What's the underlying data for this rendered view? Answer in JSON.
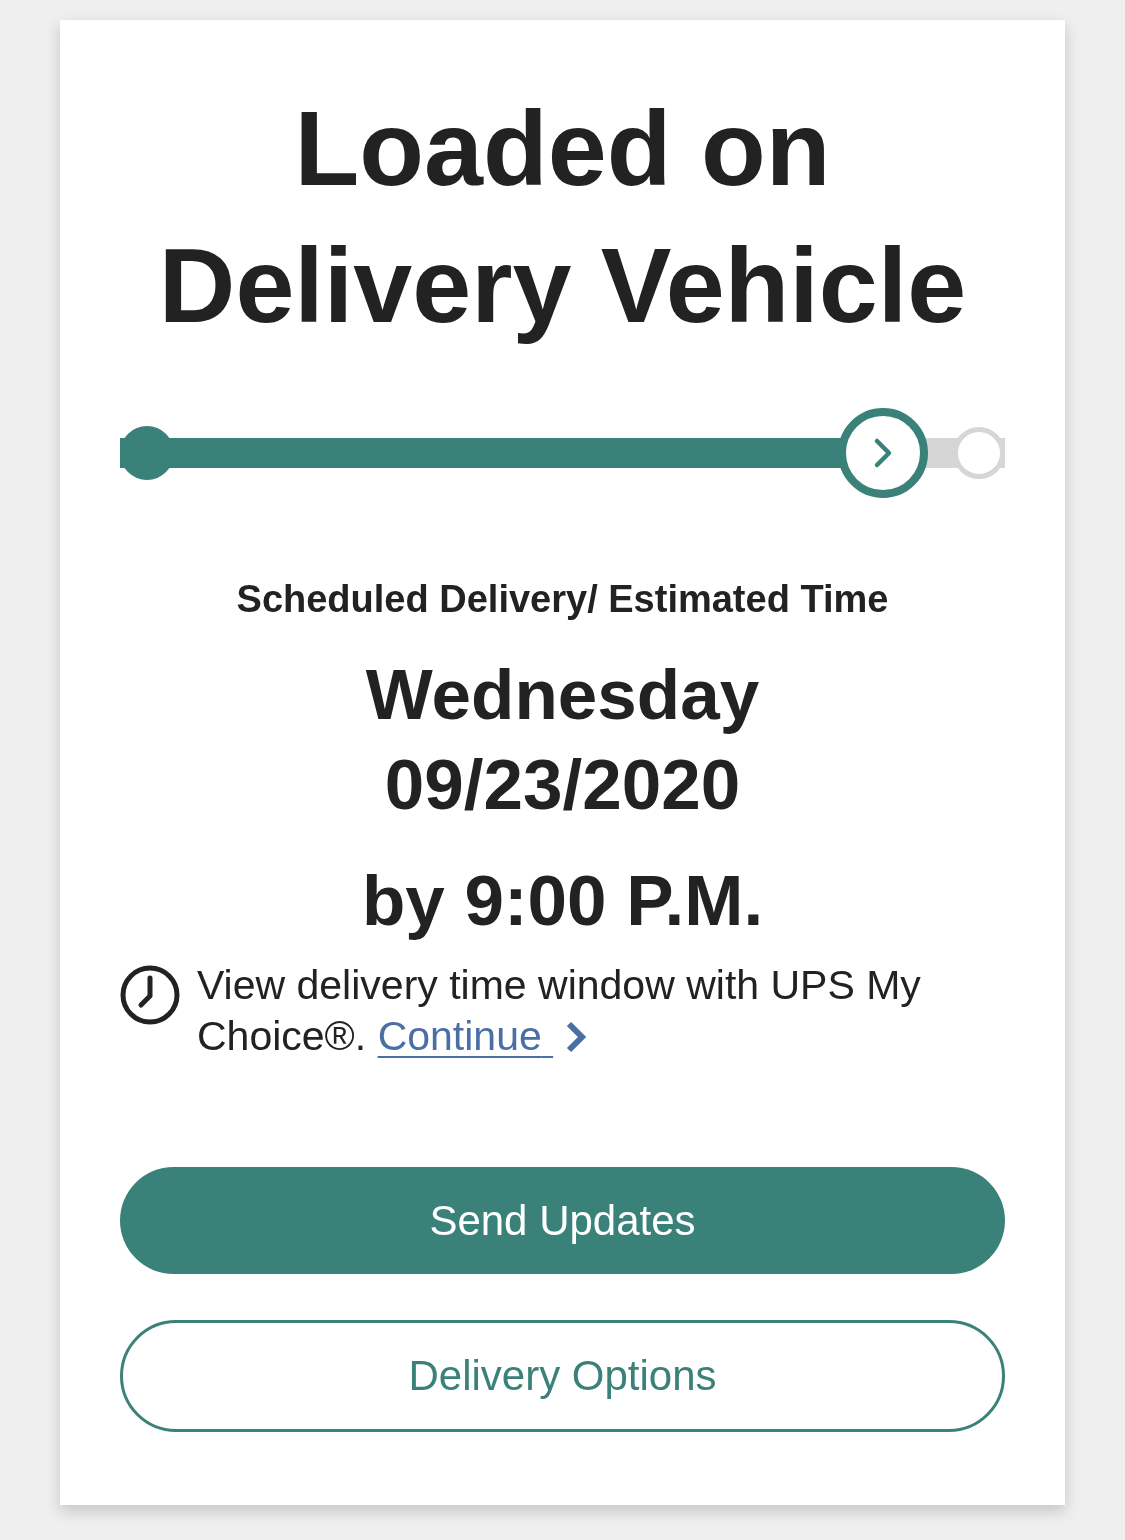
{
  "title": "Loaded on Delivery Vehicle",
  "progress": {
    "level": 0.862
  },
  "delivery": {
    "label": "Scheduled Delivery/ Estimated Time",
    "day": "Wednesday",
    "date": "09/23/2020",
    "time": "by 9:00 P.M."
  },
  "notice": {
    "text": "View delivery time window with UPS My Choice®.",
    "link": "Continue"
  },
  "buttons": [
    {
      "label": "Send Updates",
      "kind": "primary"
    },
    {
      "label": "Delivery Options",
      "kind": "outline"
    }
  ]
}
